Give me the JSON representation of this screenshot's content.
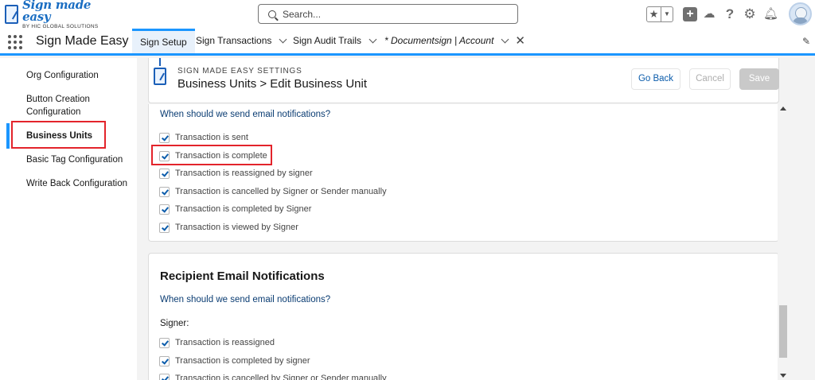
{
  "brand": {
    "title": "Sign made easy",
    "subtitle": "BY HIC GLOBAL SOLUTIONS"
  },
  "search": {
    "placeholder": "Search..."
  },
  "header_icons": [
    "favorites-star-icon",
    "add-icon",
    "trailhead-icon",
    "help-icon",
    "setup-gear-icon",
    "notifications-bell-icon",
    "user-avatar"
  ],
  "nav": {
    "app_name": "Sign Made Easy",
    "tabs": [
      {
        "label": "Sign Setup",
        "active": true
      },
      {
        "label": "Sign Transactions"
      },
      {
        "label": "Sign Audit Trails"
      },
      {
        "label": "* Documentsign | Account"
      }
    ]
  },
  "left_menu": {
    "items": [
      {
        "label": "Org Configuration"
      },
      {
        "label": "Button Creation Configuration"
      },
      {
        "label": "Business Units",
        "active": true
      },
      {
        "label": "Basic Tag Configuration"
      },
      {
        "label": "Write Back Configuration"
      }
    ]
  },
  "page_header": {
    "eyebrow": "SIGN MADE EASY SETTINGS",
    "title": "Business Units > Edit Business Unit",
    "buttons": {
      "go_back": "Go Back",
      "cancel": "Cancel",
      "save": "Save"
    }
  },
  "sender_section": {
    "question": "When should we send email notifications?",
    "options": [
      {
        "label": "Transaction is sent",
        "checked": true
      },
      {
        "label": "Transaction is complete",
        "checked": true
      },
      {
        "label": "Transaction is reassigned by signer",
        "checked": true
      },
      {
        "label": "Transaction is cancelled by Signer or Sender manually",
        "checked": true
      },
      {
        "label": "Transaction is completed by Signer",
        "checked": true
      },
      {
        "label": "Transaction is viewed by Signer",
        "checked": true
      }
    ]
  },
  "recipient_section": {
    "title": "Recipient Email Notifications",
    "question": "When should we send email notifications?",
    "signer_label": "Signer:",
    "options": [
      {
        "label": "Transaction is reassigned",
        "checked": true
      },
      {
        "label": "Transaction is completed by signer",
        "checked": true
      },
      {
        "label": "Transaction is cancelled by Signer or Sender manually",
        "checked": true
      }
    ]
  },
  "colors": {
    "accent": "#1b96ff",
    "highlight": "#e3242b",
    "link": "#0b5cab"
  }
}
